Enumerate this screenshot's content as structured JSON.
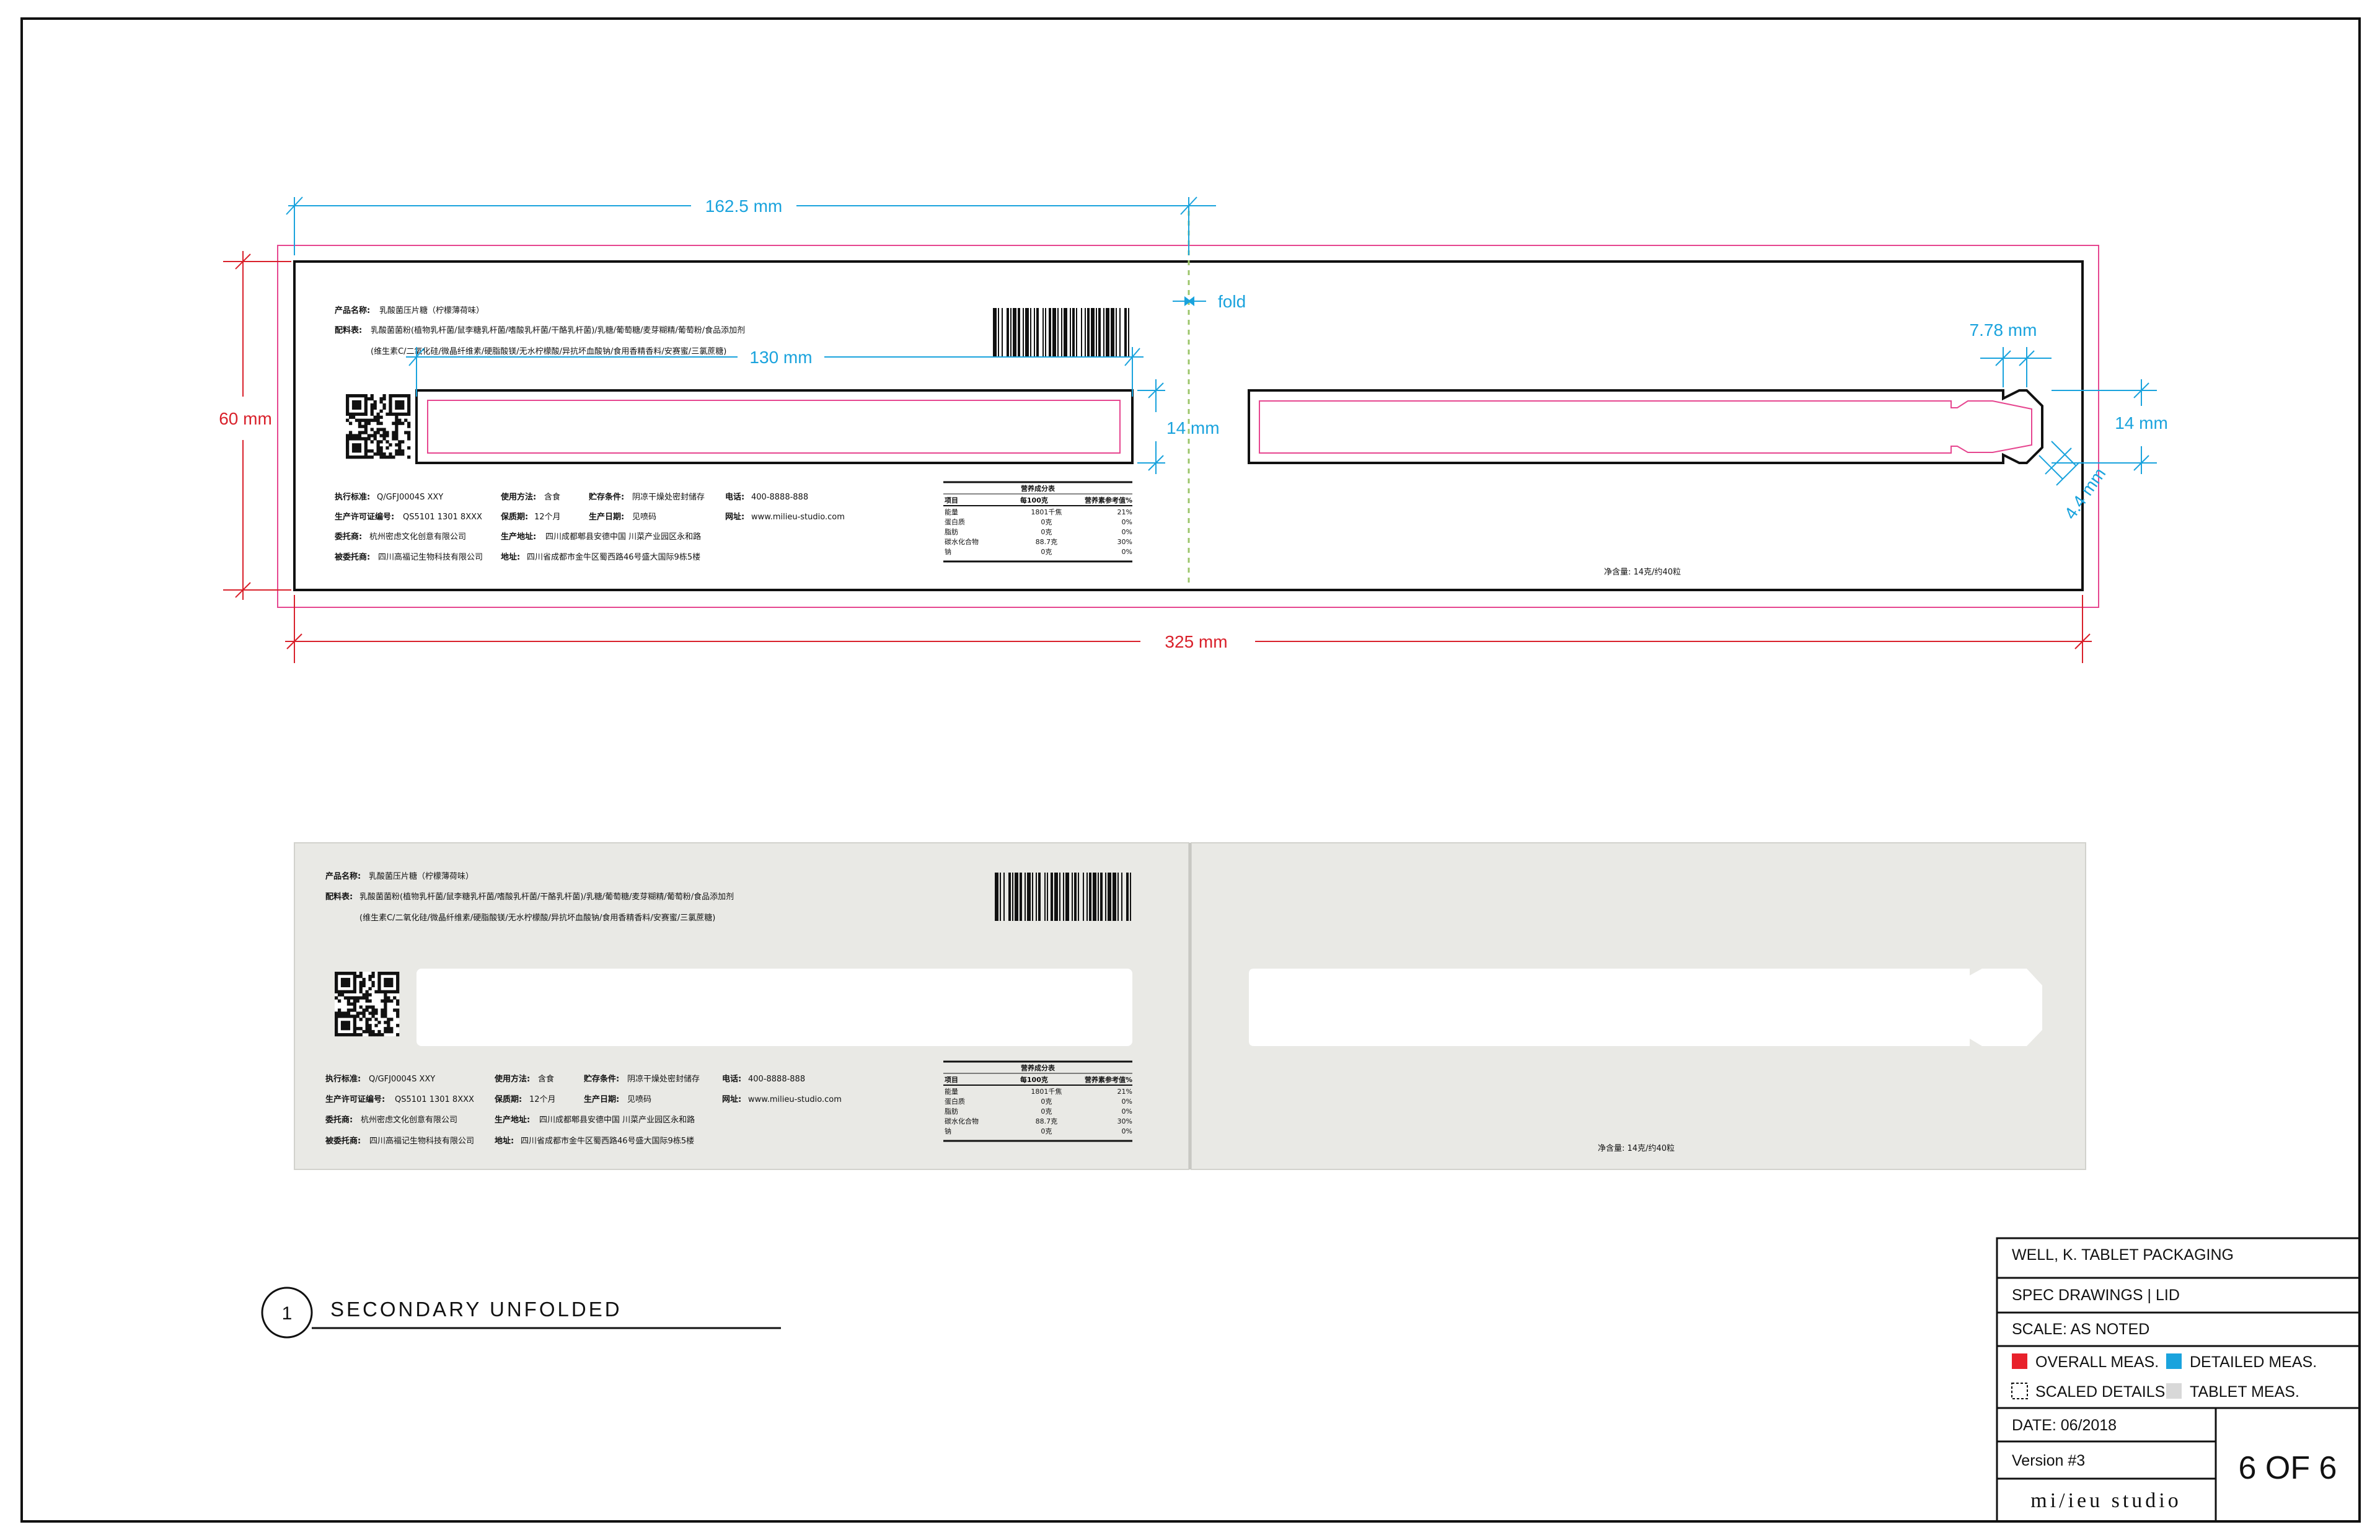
{
  "dimensions": {
    "half_width": "162.5 mm",
    "fold": "fold",
    "window_width": "130 mm",
    "window_height_left": "14 mm",
    "window_height_right": "14 mm",
    "notch": "7.78 mm",
    "notch_diag": "4.4 mm",
    "overall_height": "60 mm",
    "overall_width": "325 mm"
  },
  "label": {
    "product_name_k": "产品名称:",
    "product_name_v": "乳酸菌压片糖（柠檬薄荷味）",
    "ingredients_k": "配料表:",
    "ingredients_v1": "乳酸菌菌粉(植物乳杆菌/鼠李糖乳杆菌/嗜酸乳杆菌/干酪乳杆菌)/乳糖/葡萄糖/麦芽糊精/葡萄粉/食品添加剂",
    "ingredients_v2": "(维生素C/二氧化硅/微晶纤维素/硬脂酸镁/无水柠檬酸/异抗坏血酸钠/食用香精香料/安赛蜜/三氯蔗糖)",
    "std_k": "执行标准:",
    "std_v": "Q/GFJ0004S XXY",
    "lic_k": "生产许可证编号:",
    "lic_v": "QS5101 1301 8XXX",
    "client_k": "委托商:",
    "client_v": "杭州密虑文化创意有限公司",
    "maker_k": "被委托商:",
    "maker_v": "四川高福记生物科技有限公司",
    "use_k": "使用方法:",
    "use_v": "含食",
    "shelf_k": "保质期:",
    "shelf_v": "12个月",
    "prodaddr_k": "生产地址:",
    "prodaddr_v": "四川成都郫县安德中国 川菜产业园区永和路",
    "addr_k": "地址:",
    "addr_v": "四川省成都市金牛区蜀西路46号盛大国际9栋5楼",
    "store_k": "贮存条件:",
    "store_v": "阴凉干燥处密封储存",
    "date_k": "生产日期:",
    "date_v": "见喷码",
    "tel_k": "电话:",
    "tel_v": "400-8888-888",
    "web_k": "网址:",
    "web_v": "www.milieu-studio.com",
    "net_weight": "净含量: 14克/约40粒"
  },
  "nutrition": {
    "title": "营养成分表",
    "headers": [
      "项目",
      "每100克",
      "营养素参考值%"
    ],
    "rows": [
      [
        "能量",
        "1801千焦",
        "21%"
      ],
      [
        "蛋白质",
        "0克",
        "0%"
      ],
      [
        "脂肪",
        "0克",
        "0%"
      ],
      [
        "碳水化合物",
        "88.7克",
        "30%"
      ],
      [
        "钠",
        "0克",
        "0%"
      ]
    ]
  },
  "view_label": {
    "number": "1",
    "title": "SECONDARY UNFOLDED"
  },
  "title_block": {
    "project": "WELL, K. TABLET PACKAGING",
    "sheet": "SPEC DRAWINGS | LID",
    "scale": "SCALE: AS NOTED",
    "legend": [
      {
        "label": "OVERALL MEAS.",
        "color": "#e8212b"
      },
      {
        "label": "DETAILED MEAS.",
        "color": "#1aa3dd"
      },
      {
        "label": "SCALED DETAILS",
        "color": "none"
      },
      {
        "label": "TABLET MEAS.",
        "color": "#d8d8d8"
      }
    ],
    "date": "DATE: 06/2018",
    "version": "Version #3",
    "page": "6 OF 6",
    "studio": "mi/ieu studio"
  },
  "colors": {
    "overall": "#e8212b",
    "detailed": "#1aa3dd",
    "bleed": "#e6458f",
    "fold": "#9cc66b",
    "paper": "#e9e9e5"
  }
}
